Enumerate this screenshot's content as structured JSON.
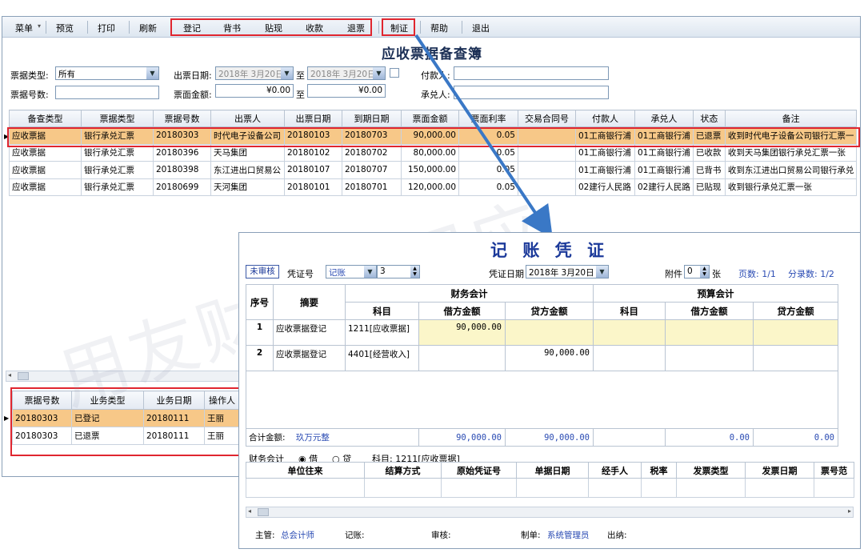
{
  "toolbar": {
    "menu": "菜单",
    "menu_arrow": "▾",
    "preview": "预览",
    "print": "打印",
    "refresh": "刷新",
    "register": "登记",
    "endorse": "背书",
    "discount": "贴现",
    "collect": "收款",
    "return_bill": "退票",
    "make_voucher": "制证",
    "help": "帮助",
    "exit": "退出"
  },
  "page_title": "应收票据备查簿",
  "filters": {
    "bill_type_label": "票据类型:",
    "bill_type_value": "所有",
    "issue_date_label": "出票日期:",
    "issue_date_from": "2018年 3月20日",
    "to_label": "至",
    "issue_date_to": "2018年 3月20日",
    "payer_label": "付款人:",
    "payer_value": "",
    "bill_no_label": "票据号数:",
    "bill_no_value": "",
    "face_amount_label": "票面金额:",
    "face_amount_from": "¥0.00",
    "to_label2": "至",
    "face_amount_to": "¥0.00",
    "acceptor_label": "承兑人:",
    "acceptor_value": ""
  },
  "main_table": {
    "headers": [
      "备查类型",
      "票据类型",
      "票据号数",
      "出票人",
      "出票日期",
      "到期日期",
      "票面金额",
      "票面利率",
      "交易合同号",
      "付款人",
      "承兑人",
      "状态",
      "备注"
    ],
    "rows": [
      [
        "应收票据",
        "银行承兑汇票",
        "20180303",
        "时代电子设备公司",
        "20180103",
        "20180703",
        "90,000.00",
        "0.05",
        "",
        "01工商银行浦",
        "01工商银行浦",
        "已退票",
        "收到时代电子设备公司银行汇票一"
      ],
      [
        "应收票据",
        "银行承兑汇票",
        "20180396",
        "天马集团",
        "20180102",
        "20180702",
        "80,000.00",
        "0.05",
        "",
        "01工商银行浦",
        "01工商银行浦",
        "已收款",
        "收到天马集团银行承兑汇票一张"
      ],
      [
        "应收票据",
        "银行承兑汇票",
        "20180398",
        "东江进出口贸易公",
        "20180107",
        "20180707",
        "150,000.00",
        "0.05",
        "",
        "01工商银行浦",
        "01工商银行浦",
        "已背书",
        "收到东江进出口贸易公司银行承兑"
      ],
      [
        "应收票据",
        "银行承兑汇票",
        "20180699",
        "天河集团",
        "20180101",
        "20180701",
        "120,000.00",
        "0.05",
        "",
        "02建行人民路",
        "02建行人民路",
        "已贴现",
        "收到银行承兑汇票一张"
      ]
    ]
  },
  "detail_table": {
    "headers": [
      "票据号数",
      "业务类型",
      "业务日期",
      "操作人"
    ],
    "rows": [
      [
        "20180303",
        "已登记",
        "20180111",
        "王丽"
      ],
      [
        "20180303",
        "已退票",
        "20180111",
        "王丽"
      ]
    ]
  },
  "voucher": {
    "title": "记 账 凭 证",
    "status": "未审核",
    "voucher_no_label": "凭证号",
    "voucher_type": "记账",
    "voucher_no": "3",
    "date_label": "凭证日期",
    "date_value": "2018年 3月20日",
    "attach_label": "附件",
    "attach_value": "0",
    "attach_unit": "张",
    "pages": "页数: 1/1",
    "entries_count": "分录数: 1/2",
    "col_seq": "序号",
    "col_summary": "摘要",
    "group_financial": "财务会计",
    "group_budget": "预算会计",
    "col_subject": "科目",
    "col_debit": "借方金额",
    "col_credit": "贷方金额",
    "rows": [
      {
        "seq": "1",
        "summary": "应收票据登记",
        "subject": "1211[应收票据]",
        "debit": "90,000.00",
        "credit": ""
      },
      {
        "seq": "2",
        "summary": "应收票据登记",
        "subject": "4401[经营收入]",
        "debit": "",
        "credit": "90,000.00"
      }
    ],
    "total_label": "合计金额:",
    "total_words": "玖万元整",
    "total_debit": "90,000.00",
    "total_credit": "90,000.00",
    "budget_debit_total": "0.00",
    "budget_credit_total": "0.00",
    "aux_prefix": "财务会计",
    "aux_debit": "借",
    "aux_credit": "贷",
    "aux_subject": "科目: 1211[应收票据]",
    "aux_headers": [
      "单位往来",
      "结算方式",
      "原始凭证号",
      "单据日期",
      "经手人",
      "税率",
      "发票类型",
      "发票日期",
      "票号范"
    ],
    "footer": {
      "supervisor_label": "主管:",
      "supervisor": "总会计师",
      "bookkeeper_label": "记账:",
      "auditor_label": "审核:",
      "maker_label": "制单:",
      "maker": "系统管理员",
      "cashier_label": "出纳:"
    }
  },
  "watermark": "用友财务公司应",
  "colors": {
    "highlight_red": "#e0262f",
    "selected_row": "#f7c888",
    "voucher_blue": "#1c3a9a",
    "arrow": "#3a78c6"
  }
}
